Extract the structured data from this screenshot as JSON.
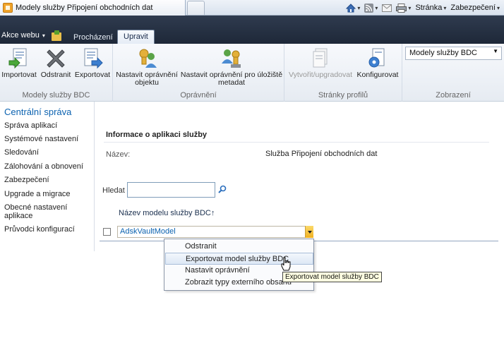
{
  "browser": {
    "tab_title": "Modely služby Připojení obchodních dat",
    "commands": [
      {
        "label": "",
        "icon": "home-icon"
      },
      {
        "label": "",
        "icon": "rss-icon"
      },
      {
        "label": "",
        "icon": "mail-icon"
      },
      {
        "label": "",
        "icon": "print-icon"
      },
      {
        "label": "Stránka",
        "icon": "page-menu"
      },
      {
        "label": "Zabezpečení",
        "icon": "security-menu"
      }
    ]
  },
  "ribbon": {
    "site_actions": "Akce webu",
    "tabs": [
      {
        "label": "Procházení",
        "active": false
      },
      {
        "label": "Upravit",
        "active": true
      }
    ],
    "groups": [
      {
        "label": "Modely služby BDC",
        "buttons": [
          {
            "label": "Importovat",
            "icon": "import-icon"
          },
          {
            "label": "Odstranit",
            "icon": "delete-icon"
          },
          {
            "label": "Exportovat",
            "icon": "export-icon"
          }
        ]
      },
      {
        "label": "Oprávnění",
        "buttons": [
          {
            "label": "Nastavit oprávnění objektu",
            "line1": "Nastavit oprávnění",
            "line2": "objektu",
            "icon": "object-permissions-icon"
          },
          {
            "label": "Nastavit oprávnění pro úložiště metadat",
            "line1": "Nastavit oprávnění pro úložiště",
            "line2": "metadat",
            "icon": "metadata-permissions-icon"
          }
        ]
      },
      {
        "label": "Stránky profilů",
        "buttons": [
          {
            "label": "Vytvořit/upgradovat",
            "icon": "create-upgrade-icon",
            "disabled": true
          },
          {
            "label": "Konfigurovat",
            "icon": "configure-icon"
          }
        ]
      },
      {
        "label": "Zobrazení",
        "select_value": "Modely služby BDC"
      }
    ]
  },
  "leftnav": {
    "heading": "Centrální správa",
    "items": [
      "Správa aplikací",
      "Systémové nastavení",
      "Sledování",
      "Zálohování a obnovení",
      "Zabezpečení",
      "Upgrade a migrace",
      "Obecné nastavení aplikace",
      "Průvodci konfigurací"
    ]
  },
  "main": {
    "section_title": "Informace o aplikaci služby",
    "name_label": "Název:",
    "name_value": "Služba Připojení obchodních dat",
    "search_label": "Hledat",
    "search_value": "",
    "column_header": "Název modelu služby BDC↑",
    "rows": [
      {
        "name": "AdskVaultModel"
      }
    ]
  },
  "context_menu": {
    "items": [
      {
        "label": "Odstranit",
        "hover": false
      },
      {
        "label": "Exportovat model služby BDC",
        "hover": true
      },
      {
        "label": "Nastavit oprávnění",
        "hover": false
      },
      {
        "label": "Zobrazit typy externího obsahu",
        "hover": false
      }
    ]
  },
  "tooltip": "Exportovat model služby BDC",
  "colors": {
    "link": "#0b62b0",
    "ribbon_dark": "#1e2838",
    "highlight": "#dde8f5"
  }
}
